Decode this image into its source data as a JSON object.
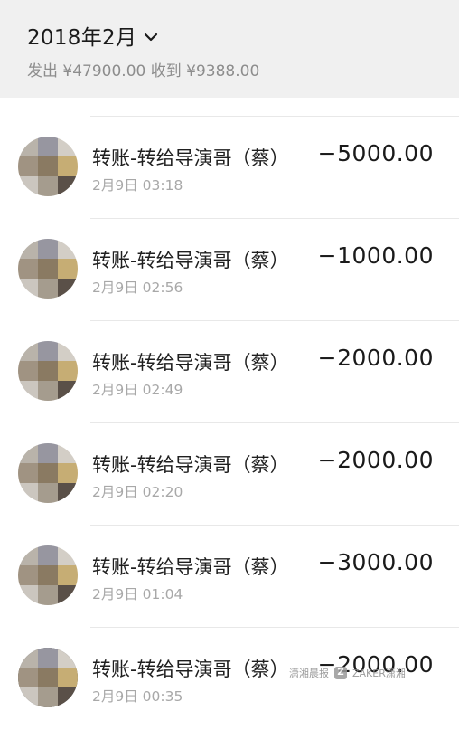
{
  "header": {
    "month": "2018年2月",
    "sent": "发出 ¥47900.00",
    "received": "收到 ¥9388.00"
  },
  "transactions": [
    {
      "title": "转账-转给导演哥（蔡）",
      "time": "2月9日 03:18",
      "amount": "−5000.00"
    },
    {
      "title": "转账-转给导演哥（蔡）",
      "time": "2月9日 02:56",
      "amount": "−1000.00"
    },
    {
      "title": "转账-转给导演哥（蔡）",
      "time": "2月9日 02:49",
      "amount": "−2000.00"
    },
    {
      "title": "转账-转给导演哥（蔡）",
      "time": "2月9日 02:20",
      "amount": "−2000.00"
    },
    {
      "title": "转账-转给导演哥（蔡）",
      "time": "2月9日 01:04",
      "amount": "−3000.00"
    },
    {
      "title": "转账-转给导演哥（蔡）",
      "time": "2月9日 00:35",
      "amount": "−2000.00"
    }
  ],
  "watermark": {
    "left": "潇湘晨报",
    "logo": "Z",
    "right": "ZAKER潇湘"
  },
  "colors": {
    "header_bg": "#f0f0f0",
    "text_primary": "#1a1a1a",
    "text_secondary": "#8d8d8d",
    "divider": "#e8e8e8"
  },
  "icons": {
    "month_toggle": "chevron-down-icon",
    "avatar": "pixelated-avatar"
  }
}
